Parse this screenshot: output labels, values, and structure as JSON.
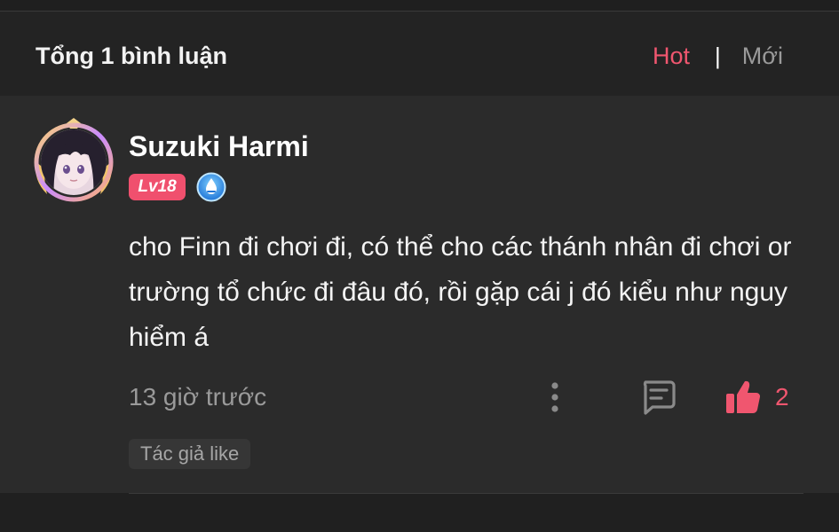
{
  "header": {
    "title": "Tổng 1 bình luận",
    "tabs": {
      "hot": "Hot",
      "separator": "|",
      "new": "Mới"
    },
    "active_tab": "hot"
  },
  "comment": {
    "username": "Suzuki Harmi",
    "level_badge": "Lv18",
    "verify_icon": "blue-drop-badge-icon",
    "text": "cho Finn đi chơi đi, có thể cho các thánh nhân đi chơi or trường tổ chức đi đâu đó, rồi gặp cái j đó kiểu như nguy hiểm á",
    "timestamp": "13 giờ trước",
    "like_count": "2",
    "author_like_tag": "Tác giả like",
    "icons": {
      "more": "vertical-dots-icon",
      "reply": "comment-bubble-icon",
      "like": "thumbs-up-icon"
    }
  },
  "colors": {
    "accent": "#f0566f",
    "background": "#202020",
    "card": "#2b2b2b",
    "muted": "#9a9a9a"
  }
}
